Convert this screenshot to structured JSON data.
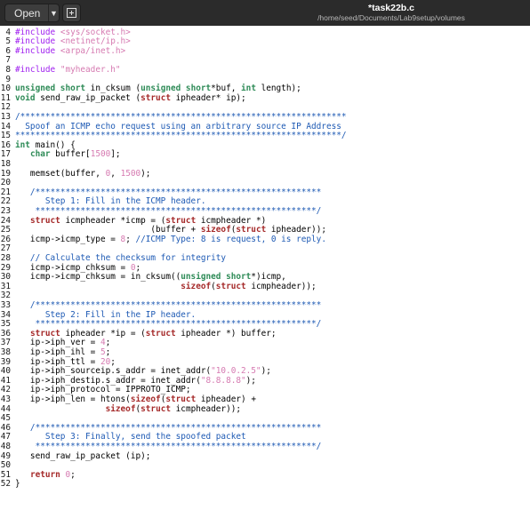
{
  "window": {
    "title": "*task22b.c",
    "subtitle": "/home/seed/Documents/Lab9setup/volumes"
  },
  "toolbar": {
    "open_label": "Open",
    "open_menu_icon": "chevron-down-icon",
    "new_tab_icon": "new-document-icon"
  },
  "editor": {
    "first_line_number": 4,
    "lines": [
      [
        [
          "pp",
          "#include "
        ],
        [
          "st",
          "<sys/socket.h>"
        ]
      ],
      [
        [
          "pp",
          "#include "
        ],
        [
          "st",
          "<netinet/ip.h>"
        ]
      ],
      [
        [
          "pp",
          "#include "
        ],
        [
          "st",
          "<arpa/inet.h>"
        ]
      ],
      [],
      [
        [
          "pp",
          "#include "
        ],
        [
          "st",
          "\"myheader.h\""
        ]
      ],
      [],
      [
        [
          "ty",
          "unsigned short"
        ],
        [
          "",
          "in_cksum ("
        ],
        [
          "ty",
          "unsigned short"
        ],
        [
          "",
          "*buf, "
        ],
        [
          "ty",
          "int"
        ],
        [
          "",
          "length);"
        ]
      ],
      [
        [
          "ty",
          "void"
        ],
        [
          "",
          "send_raw_ip_packet ("
        ],
        [
          "kw",
          "struct"
        ],
        [
          "",
          "ipheader* ip);"
        ]
      ],
      [],
      [
        [
          "cm",
          "/*****************************************************************"
        ]
      ],
      [
        [
          "cm",
          "  Spoof an ICMP echo request using an arbitrary source IP Address"
        ]
      ],
      [
        [
          "cm",
          "*****************************************************************/"
        ]
      ],
      [
        [
          "ty",
          "int"
        ],
        [
          "",
          "main() {"
        ]
      ],
      [
        [
          "",
          "   "
        ],
        [
          "ty",
          "char"
        ],
        [
          "",
          "buffer["
        ],
        [
          "nm",
          "1500"
        ],
        [
          "",
          "];"
        ]
      ],
      [],
      [
        [
          "",
          "   memset(buffer, "
        ],
        [
          "nm",
          "0"
        ],
        [
          "",
          ", "
        ],
        [
          "nm",
          "1500"
        ],
        [
          "",
          ");"
        ]
      ],
      [],
      [
        [
          "cm",
          "   /*********************************************************"
        ]
      ],
      [
        [
          "cm",
          "      Step 1: Fill in the ICMP header."
        ]
      ],
      [
        [
          "cm",
          "    ********************************************************/"
        ]
      ],
      [
        [
          "",
          "   "
        ],
        [
          "kw",
          "struct"
        ],
        [
          "",
          "icmpheader *icmp = ("
        ],
        [
          "kw",
          "struct"
        ],
        [
          "",
          "icmpheader *)"
        ]
      ],
      [
        [
          "",
          "                           (buffer + "
        ],
        [
          "kw",
          "sizeof"
        ],
        [
          "",
          "("
        ],
        [
          "kw",
          "struct"
        ],
        [
          "",
          "ipheader));"
        ]
      ],
      [
        [
          "",
          "   icmp->icmp_type = "
        ],
        [
          "nm",
          "8"
        ],
        [
          "",
          "; "
        ],
        [
          "cm",
          "//ICMP Type: 8 is request, 0 is reply."
        ]
      ],
      [],
      [
        [
          "cm",
          "   // Calculate the checksum for integrity"
        ]
      ],
      [
        [
          "",
          "   icmp->icmp_chksum = "
        ],
        [
          "nm",
          "0"
        ],
        [
          "",
          ";"
        ]
      ],
      [
        [
          "",
          "   icmp->icmp_chksum = in_cksum(("
        ],
        [
          "ty",
          "unsigned short"
        ],
        [
          "",
          "*)icmp,"
        ]
      ],
      [
        [
          "",
          "                                 "
        ],
        [
          "kw",
          "sizeof"
        ],
        [
          "",
          "("
        ],
        [
          "kw",
          "struct"
        ],
        [
          "",
          "icmpheader));"
        ]
      ],
      [],
      [
        [
          "cm",
          "   /*********************************************************"
        ]
      ],
      [
        [
          "cm",
          "      Step 2: Fill in the IP header."
        ]
      ],
      [
        [
          "cm",
          "    ********************************************************/"
        ]
      ],
      [
        [
          "",
          "   "
        ],
        [
          "kw",
          "struct"
        ],
        [
          "",
          "ipheader *ip = ("
        ],
        [
          "kw",
          "struct"
        ],
        [
          "",
          "ipheader *) buffer;"
        ]
      ],
      [
        [
          "",
          "   ip->iph_ver = "
        ],
        [
          "nm",
          "4"
        ],
        [
          "",
          ";"
        ]
      ],
      [
        [
          "",
          "   ip->iph_ihl = "
        ],
        [
          "nm",
          "5"
        ],
        [
          "",
          ";"
        ]
      ],
      [
        [
          "",
          "   ip->iph_ttl = "
        ],
        [
          "nm",
          "20"
        ],
        [
          "",
          ";"
        ]
      ],
      [
        [
          "",
          "   ip->iph_sourceip.s_addr = inet_addr("
        ],
        [
          "st",
          "\"10.0.2.5\""
        ],
        [
          "",
          ");"
        ]
      ],
      [
        [
          "",
          "   ip->iph_destip.s_addr = inet_addr("
        ],
        [
          "st",
          "\"8.8.8.8\""
        ],
        [
          "",
          ");"
        ]
      ],
      [
        [
          "",
          "   ip->iph_protocol = IPPROTO_ICMP;"
        ]
      ],
      [
        [
          "",
          "   ip->iph_len = htons("
        ],
        [
          "kw",
          "sizeof"
        ],
        [
          "",
          "("
        ],
        [
          "kw",
          "struct"
        ],
        [
          "",
          "ipheader) +"
        ]
      ],
      [
        [
          "",
          "                  "
        ],
        [
          "kw",
          "sizeof"
        ],
        [
          "",
          "("
        ],
        [
          "kw",
          "struct"
        ],
        [
          "",
          "icmpheader));"
        ]
      ],
      [],
      [
        [
          "cm",
          "   /*********************************************************"
        ]
      ],
      [
        [
          "cm",
          "      Step 3: Finally, send the spoofed packet"
        ]
      ],
      [
        [
          "cm",
          "    ********************************************************/"
        ]
      ],
      [
        [
          "",
          "   send_raw_ip_packet (ip);"
        ]
      ],
      [],
      [
        [
          "",
          "   "
        ],
        [
          "kw",
          "return"
        ],
        [
          "",
          ""
        ],
        [
          "nm",
          "0"
        ],
        [
          "",
          ";"
        ]
      ],
      [
        [
          "",
          "}"
        ]
      ]
    ]
  }
}
